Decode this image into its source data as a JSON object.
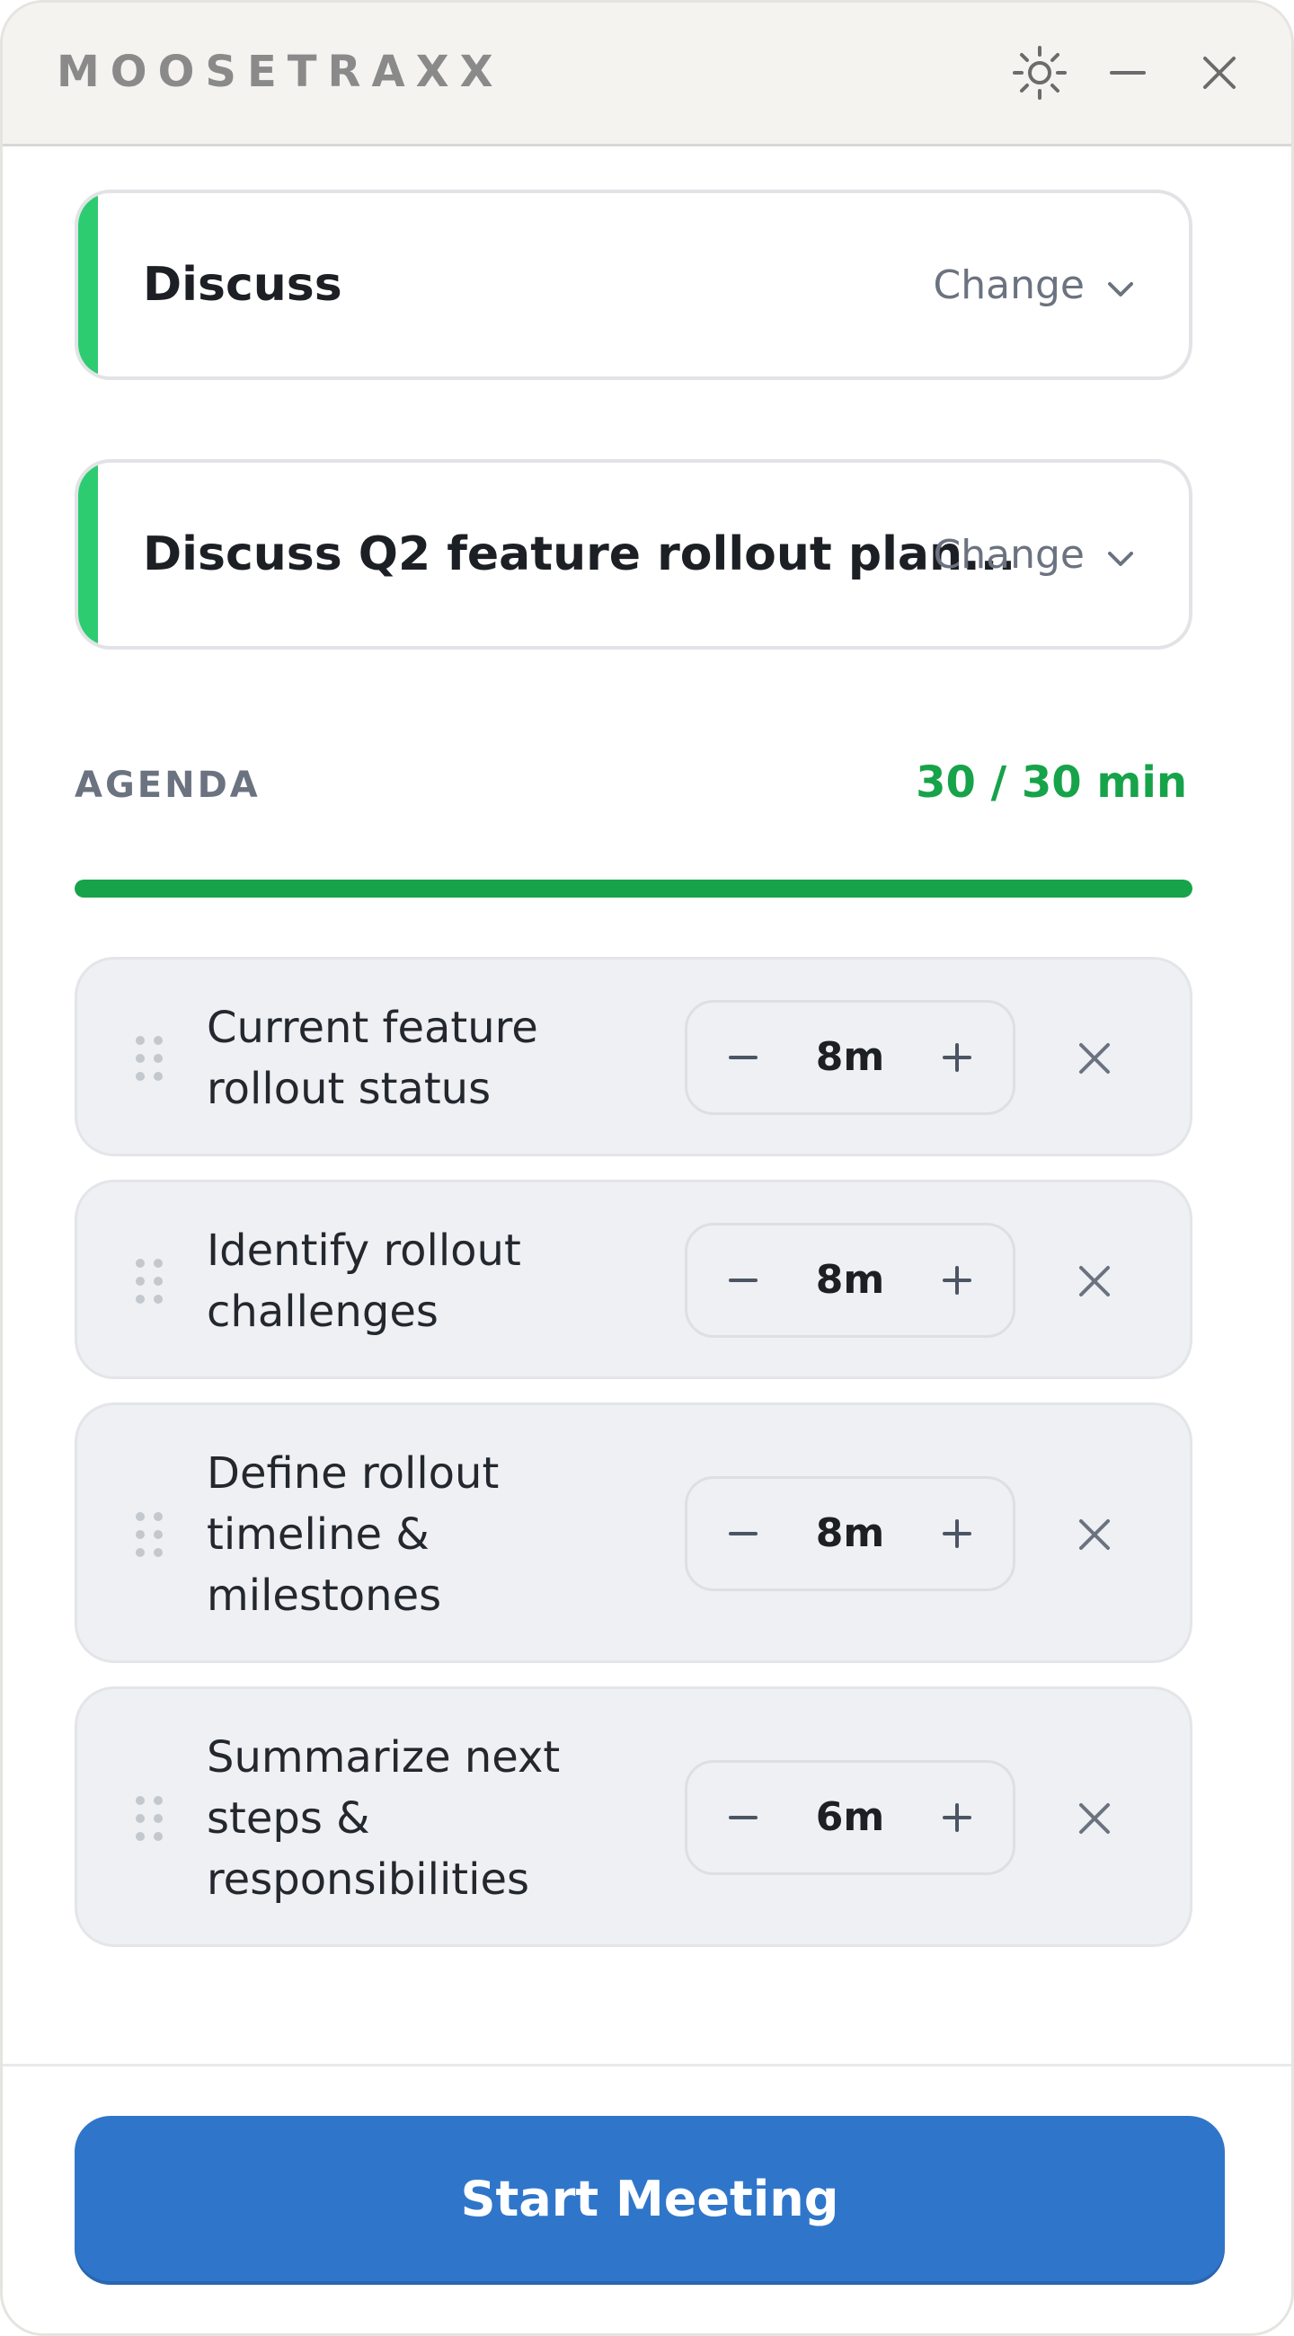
{
  "app": {
    "title": "MOOSETRAXX",
    "theme_icon": "sun-icon",
    "minimize_icon": "minimize-icon",
    "close_icon": "close-icon"
  },
  "selectors": [
    {
      "value": "Discuss",
      "change_label": "Change",
      "accent_color": "#2ecc71"
    },
    {
      "value": "Discuss Q2 feature rollout plan...",
      "change_label": "Change",
      "accent_color": "#2ecc71"
    }
  ],
  "agenda": {
    "label": "AGENDA",
    "total": "30 / 30 min",
    "progress_fraction": 1.0,
    "progress_color": "#16a34a",
    "items": [
      {
        "text": "Current feature rollout status",
        "duration": "8m"
      },
      {
        "text": "Identify rollout challenges",
        "duration": "8m"
      },
      {
        "text": "Define rollout timeline & milestones",
        "duration": "8m"
      },
      {
        "text": "Summarize next steps & responsibilities",
        "duration": "6m"
      }
    ]
  },
  "footer": {
    "start_label": "Start Meeting",
    "button_color": "#2f76cb"
  }
}
